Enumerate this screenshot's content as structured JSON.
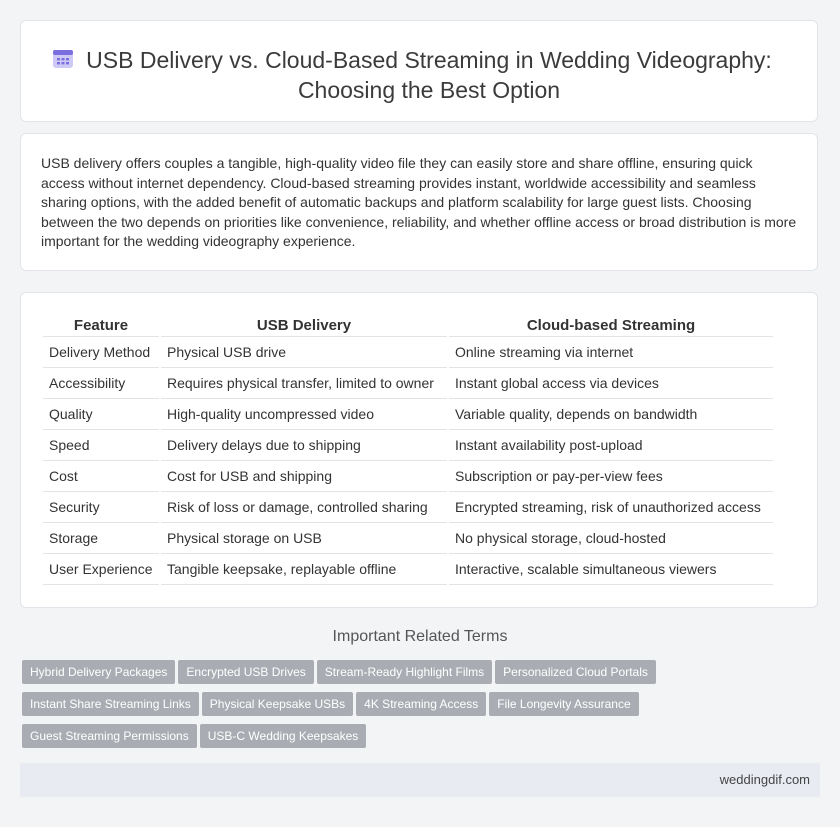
{
  "header": {
    "title": "USB Delivery vs. Cloud-Based Streaming in Wedding Videography: Choosing the Best Option",
    "icon": "calendar-icon"
  },
  "summary": "USB delivery offers couples a tangible, high-quality video file they can easily store and share offline, ensuring quick access without internet dependency. Cloud-based streaming provides instant, worldwide accessibility and seamless sharing options, with the added benefit of automatic backups and platform scalability for large guest lists. Choosing between the two depends on priorities like convenience, reliability, and whether offline access or broad distribution is more important for the wedding videography experience.",
  "table": {
    "headers": [
      "Feature",
      "USB Delivery",
      "Cloud-based Streaming"
    ],
    "rows": [
      [
        "Delivery Method",
        "Physical USB drive",
        "Online streaming via internet"
      ],
      [
        "Accessibility",
        "Requires physical transfer, limited to owner",
        "Instant global access via devices"
      ],
      [
        "Quality",
        "High-quality uncompressed video",
        "Variable quality, depends on bandwidth"
      ],
      [
        "Speed",
        "Delivery delays due to shipping",
        "Instant availability post-upload"
      ],
      [
        "Cost",
        "Cost for USB and shipping",
        "Subscription or pay-per-view fees"
      ],
      [
        "Security",
        "Risk of loss or damage, controlled sharing",
        "Encrypted streaming, risk of unauthorized access"
      ],
      [
        "Storage",
        "Physical storage on USB",
        "No physical storage, cloud-hosted"
      ],
      [
        "User Experience",
        "Tangible keepsake, replayable offline",
        "Interactive, scalable simultaneous viewers"
      ]
    ]
  },
  "related": {
    "title": "Important Related Terms",
    "tags": [
      "Hybrid Delivery Packages",
      "Encrypted USB Drives",
      "Stream-Ready Highlight Films",
      "Personalized Cloud Portals",
      "Instant Share Streaming Links",
      "Physical Keepsake USBs",
      "4K Streaming Access",
      "File Longevity Assurance",
      "Guest Streaming Permissions",
      "USB-C Wedding Keepsakes"
    ]
  },
  "footer": {
    "site": "weddingdif.com"
  },
  "colors": {
    "tag_bg": "#a9adb3",
    "page_bg": "#f3f4f6",
    "icon_accent": "#7b6fe0"
  }
}
